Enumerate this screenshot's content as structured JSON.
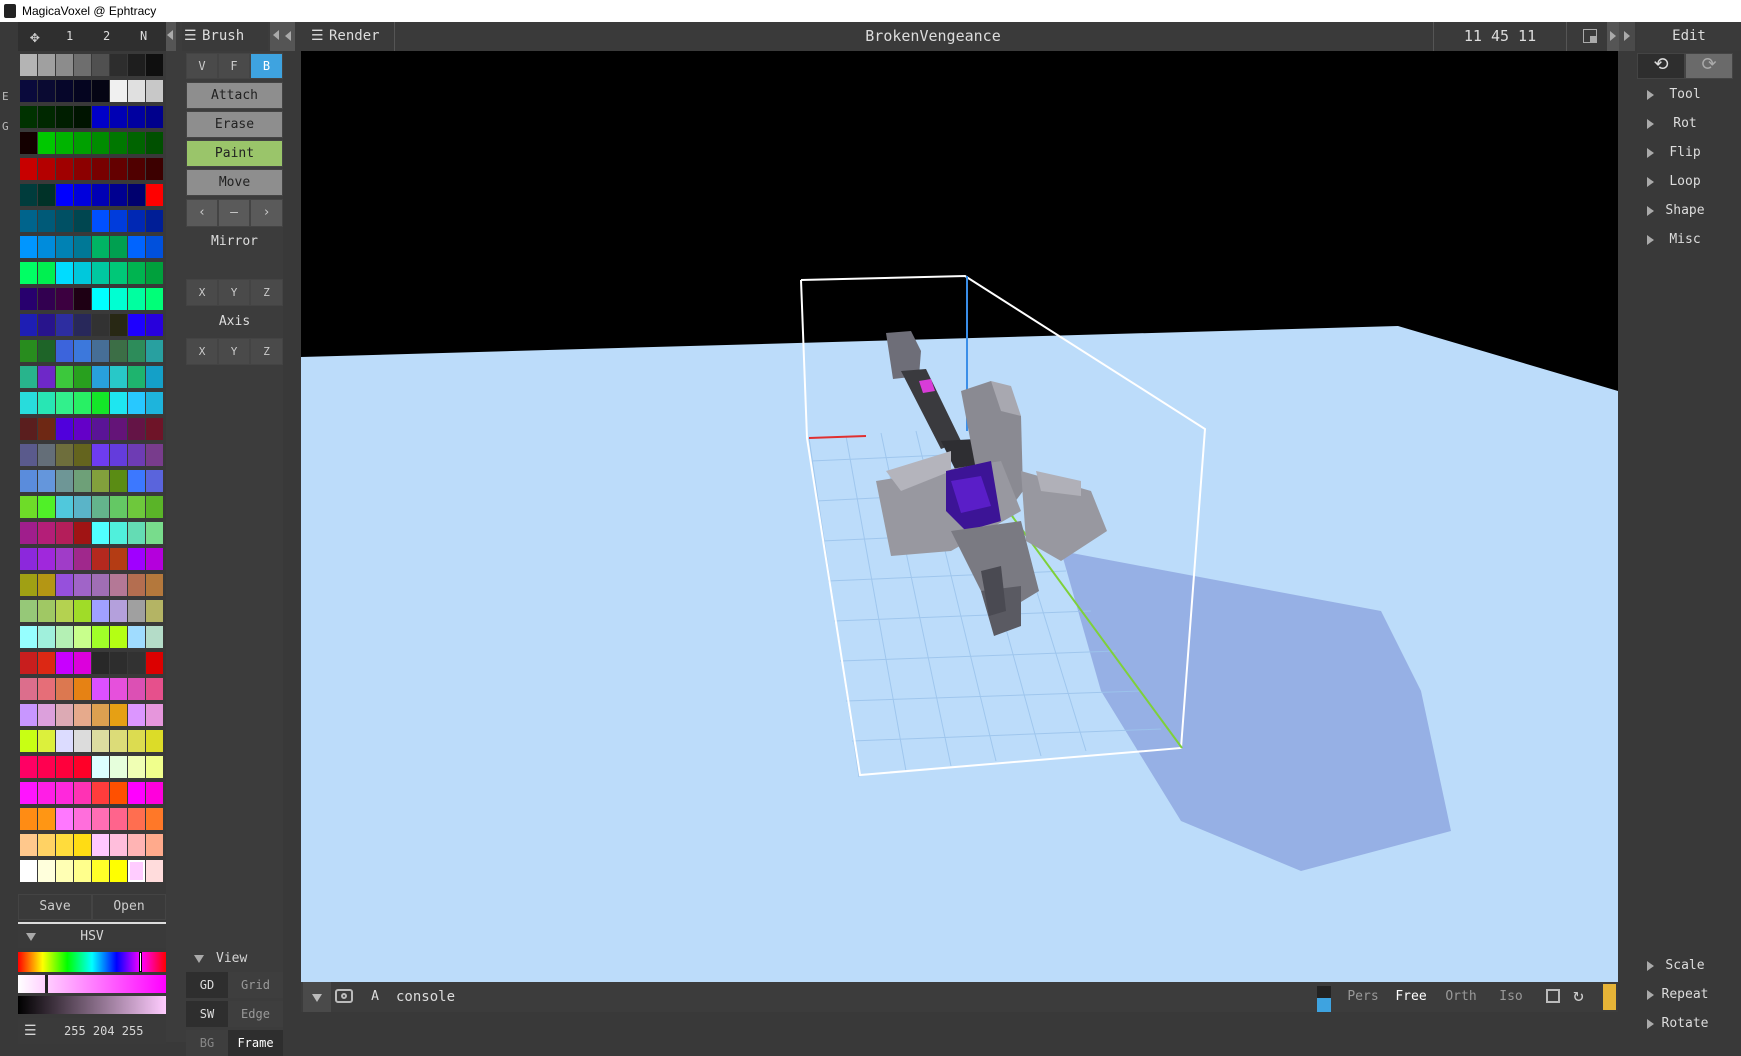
{
  "window": {
    "title": "MagicaVoxel @ Ephtracy"
  },
  "left_panel": {
    "tabs": [
      "1",
      "2",
      "N"
    ],
    "side_letters": [
      "E",
      "G"
    ],
    "palette_colors": [
      "#b4b4b4",
      "#a0a0a0",
      "#8c8c8c",
      "#6e6e6e",
      "#505050",
      "#2d2d2d",
      "#1e1e1e",
      "#0f0f0f",
      "#0a0a3c",
      "#0a0a32",
      "#06062a",
      "#050520",
      "#050514",
      "#f0f0f0",
      "#e0e0e0",
      "#c8c8c8",
      "#003200",
      "#002800",
      "#001e00",
      "#001400",
      "#0000c8",
      "#0000b4",
      "#0000a0",
      "#00008c",
      "#140000",
      "#00c800",
      "#00b400",
      "#00a000",
      "#008c00",
      "#007800",
      "#006400",
      "#005000",
      "#c80000",
      "#b40000",
      "#a00000",
      "#8c0000",
      "#780000",
      "#640000",
      "#500000",
      "#3c0000",
      "#003c3c",
      "#003228",
      "#0000ff",
      "#0000dc",
      "#0000b4",
      "#000090",
      "#00006e",
      "#ff0000",
      "#00648c",
      "#005a78",
      "#005064",
      "#004650",
      "#0050ff",
      "#003cdc",
      "#0028b4",
      "#001e96",
      "#0096ff",
      "#008cdc",
      "#0082b4",
      "#007896",
      "#00b464",
      "#00a050",
      "#0064ff",
      "#0050dc",
      "#00ff64",
      "#00f050",
      "#00dcff",
      "#00c8dc",
      "#00c8a0",
      "#00c878",
      "#00b450",
      "#00a03c",
      "#28006e",
      "#320050",
      "#3c0040",
      "#1e0014",
      "#00ffff",
      "#00ffd2",
      "#00ffa0",
      "#00ff78",
      "#1e1eb4",
      "#28148c",
      "#2d2da0",
      "#28285a",
      "#323232",
      "#282814",
      "#1e00ff",
      "#2800dc",
      "#288c1e",
      "#1e6428",
      "#3c64dc",
      "#3c78dc",
      "#466e96",
      "#3c6e46",
      "#2d8c5a",
      "#28a0a0",
      "#28b48c",
      "#6e28c8",
      "#3cc83c",
      "#28a01e",
      "#28a0dc",
      "#28c8c8",
      "#1eb46e",
      "#14a0c8",
      "#28dcdc",
      "#28e6b4",
      "#32f08c",
      "#28f064",
      "#14e628",
      "#1ee6f0",
      "#28c8ff",
      "#1eb4dc",
      "#5a1e1e",
      "#6e2814",
      "#5000dc",
      "#6400c8",
      "#5a1496",
      "#641478",
      "#641446",
      "#6e1428",
      "#5a5a8c",
      "#646e78",
      "#6e6e3c",
      "#64641e",
      "#6e3cf0",
      "#643cdc",
      "#6e3cb4",
      "#783c8c",
      "#5a8cdc",
      "#6496dc",
      "#6e9696",
      "#6ea078",
      "#82a03c",
      "#5a8c14",
      "#3c78ff",
      "#5a64dc",
      "#6edc28",
      "#50f028",
      "#50c8dc",
      "#5ab4c8",
      "#64b48c",
      "#64c864",
      "#6ec83c",
      "#5ab428",
      "#a01e8c",
      "#b41e78",
      "#b41e5a",
      "#a01414",
      "#50ffff",
      "#50f0dc",
      "#64dcb4",
      "#78dc8c",
      "#8c28dc",
      "#a028dc",
      "#a03cc8",
      "#a0288c",
      "#b4281e",
      "#b43c14",
      "#a000ff",
      "#b400dc",
      "#a0a014",
      "#b49614",
      "#9650dc",
      "#a064c8",
      "#a06eb4",
      "#b47896",
      "#b46e50",
      "#b4783c",
      "#96c878",
      "#a0c864",
      "#b4d250",
      "#a0dc28",
      "#a0a0ff",
      "#b4a0dc",
      "#a0a0a0",
      "#b4b464",
      "#96ffff",
      "#a0f0dc",
      "#b4f0b4",
      "#c8ff8c",
      "#a0ff28",
      "#b4ff14",
      "#a0dcff",
      "#b4dcc8",
      "#c81e1e",
      "#dc2814",
      "#c800ff",
      "#dc00dc",
      "#282828",
      "#2d2d2d",
      "#323232",
      "#dc0000",
      "#dc6e8c",
      "#e66e78",
      "#dc7850",
      "#e68214",
      "#dc50ff",
      "#e650dc",
      "#dc50b4",
      "#e6508c",
      "#c896ff",
      "#dca0dc",
      "#dcaab4",
      "#e6aa8c",
      "#dca050",
      "#e6a014",
      "#dc96ff",
      "#e696dc",
      "#c8ff14",
      "#dcf03c",
      "#dcdcff",
      "#dcdcdc",
      "#dcdca0",
      "#dcdc78",
      "#dcdc50",
      "#dcdc28",
      "#ff0064",
      "#ff0050",
      "#ff003c",
      "#ff0028",
      "#dcffff",
      "#e6ffdc",
      "#f0ffb4",
      "#f0ff8c",
      "#ff14ff",
      "#ff1ee6",
      "#ff28dc",
      "#ff32b4",
      "#ff3c3c",
      "#ff5000",
      "#ff00ff",
      "#ff00dc",
      "#ff8c14",
      "#ff9614",
      "#ff78ff",
      "#ff6edc",
      "#ff6eb4",
      "#ff648c",
      "#ff6e50",
      "#ff7828",
      "#ffc88c",
      "#ffd264",
      "#ffdc3c",
      "#ffdc14",
      "#ffc8ff",
      "#ffbedc",
      "#ffb4b4",
      "#ffaa8c",
      "#ffffff",
      "#ffffdc",
      "#ffffb4",
      "#ffff8c",
      "#ffff28",
      "#ffff00",
      "#ffccff",
      "#ffdcdc"
    ],
    "save_label": "Save",
    "open_label": "Open",
    "hsv_label": "HSV",
    "color_value": "255 204 255",
    "selected_color": "#ffccff"
  },
  "brush_panel": {
    "title": "Brush",
    "modes": [
      "V",
      "F",
      "B"
    ],
    "actions": [
      "Attach",
      "Erase",
      "Paint",
      "Move"
    ],
    "nav": [
      "‹",
      "–",
      "›"
    ],
    "mirror_label": "Mirror",
    "mirror_axes": [
      "X",
      "Y",
      "Z"
    ],
    "axis_label": "Axis",
    "axis_axes": [
      "X",
      "Y",
      "Z"
    ],
    "view_label": "View",
    "view_rows": [
      [
        "GD",
        "Grid"
      ],
      [
        "SW",
        "Edge"
      ],
      [
        "BG",
        "Frame"
      ]
    ]
  },
  "render_header": {
    "label": "Render",
    "project_name": "BrokenVengeance",
    "dimensions": "11 45 11"
  },
  "edit_panel": {
    "title": "Edit",
    "items": [
      "Tool",
      "Rot",
      "Flip",
      "Loop",
      "Shape",
      "Misc"
    ],
    "bottom_items": [
      "Scale",
      "Repeat",
      "Rotate"
    ]
  },
  "bottom_bar": {
    "a_label": "A",
    "console_label": "console",
    "camera_modes": [
      "Pers",
      "Free",
      "Orth",
      "Iso"
    ],
    "active_camera": "Free"
  },
  "colors": {
    "accent_blue": "#3ea3e0",
    "paint_green": "#9ac56a",
    "sky": "#bcdcfa",
    "status_yellow": "#e6b437"
  }
}
